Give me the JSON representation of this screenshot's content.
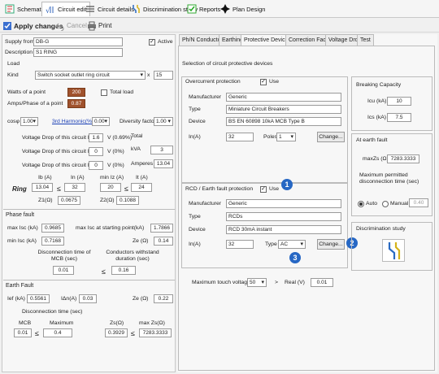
{
  "tabs": [
    {
      "label": "Schematic",
      "icon": "schematic-icon"
    },
    {
      "label": "Circuit edit",
      "icon": "circuit-edit-icon"
    },
    {
      "label": "Circuit details",
      "icon": "circuit-details-icon"
    },
    {
      "label": "Discrimination study",
      "icon": "discrimination-icon"
    },
    {
      "label": "Reports",
      "icon": "reports-icon"
    },
    {
      "label": "Plan Design",
      "icon": "plan-design-icon"
    }
  ],
  "toolbar": {
    "apply": "Apply changes",
    "cancel": "Cancel",
    "print": "Print"
  },
  "left": {
    "supply_from_label": "Supply from",
    "supply_from": "DB-G",
    "active_label": "Active",
    "description_label": "Description",
    "description": "S1 RING",
    "load_header": "Load",
    "kind_label": "Kind",
    "kind": "Switch socket outlet ring circuit",
    "mult": "x",
    "qty": "15",
    "watts_label": "Watts of a point",
    "watts": "200",
    "total_load_label": "Total load",
    "amps_label": "Amps/Phase of a point",
    "amps": "0.87",
    "cosphi_label": "cosφ",
    "cosphi": "1.00",
    "harmonic_label": "3rd Harmonic(%)",
    "harmonic": "0.00",
    "diversity_label": "Diversity factor",
    "diversity": "1.00",
    "vd_l1_label": "Voltage Drop of this circuit L1",
    "vd_l1": "1.6",
    "vd_l1_unit": "V (0.69%)",
    "vd_l2_label": "Voltage Drop of this circuit L2",
    "vd_l2": "0",
    "vd_l2_unit": "V (0%)",
    "vd_l3_label": "Voltage Drop of this circuit L3",
    "vd_l3": "0",
    "vd_l3_unit": "V (0%)",
    "total_label": "Total",
    "kva_label": "kVA",
    "kva": "3",
    "amperes_label": "Amperes",
    "amperes": "13.04",
    "ib_label": "Ib (A)",
    "ib": "13.04",
    "in_label": "In (A)",
    "in": "32",
    "minIz_label": "min Iz (A)",
    "minIz": "20",
    "it_label": "It (A)",
    "it": "24",
    "ring_label": "Ring",
    "le1": "≤",
    "le2": "≤",
    "le3": "≤",
    "z1_label": "Z1(Ω)",
    "z1": "0.0675",
    "z2_label": "Z2(Ω)",
    "z2": "0.1088",
    "phase_fault_header": "Phase fault",
    "maxIsc_label": "max Isc (kA)",
    "maxIsc": "0.9685",
    "maxIscStart_label": "max Isc at starting point(kA)",
    "maxIscStart": "1.7866",
    "minIsc_label": "min Isc (kA)",
    "minIsc": "0.7168",
    "ze_label": "Ze (Ω)",
    "ze": "0.14",
    "disc_mcb_label": "Disconnection time of MCB (sec)",
    "disc_mcb": "0.01",
    "le_pf": "≤",
    "withstand_label": "Conductors withstand duration (sec)",
    "withstand": "0.16",
    "earth_fault_header": "Earth Fault",
    "ief_label": "Ief (kA)",
    "ief": "0.5561",
    "idn_label": "IΔn(A)",
    "idn": "0.03",
    "ze2_label": "Ze (Ω)",
    "ze2": "0.22",
    "disc_time_label": "Disconnection time (sec)",
    "mcb_label": "MCB",
    "mcb": "0.01",
    "max_label": "Maximum",
    "max": "0.4",
    "zs_label": "Zs(Ω)",
    "zs": "0.3929",
    "maxzs_label": "max Zs(Ω)",
    "maxzs": "7283.3333",
    "le_ef1": "≤",
    "le_ef2": "≤"
  },
  "right": {
    "tabs": [
      "Ph/N Conductor",
      "Earthing",
      "Protective Devices",
      "Correction Factors",
      "Voltage Drop",
      "Test"
    ],
    "selection_title": "Selection of circuit protective devices",
    "overcurrent_label": "Overcurrent protection",
    "use_label": "Use",
    "manufacturer_label": "Manufacturer",
    "manufacturer": "Generic",
    "type_label": "Type",
    "type": "Miniature Circuit Breakers",
    "device_label": "Device",
    "device": "BS EN 60898 10kA MCB Type B",
    "in_label": "In(A)",
    "in": "32",
    "poles_label": "Poles",
    "poles": "1",
    "change_label": "Change...",
    "breaking_title": "Breaking Capacity",
    "icu_label": "Icu (kA)",
    "icu": "10",
    "ics_label": "Ics (kA)",
    "ics": "7.5",
    "atearth_title": "At earth fault",
    "maxzs_label": "maxZs (Ω)",
    "maxzs": "7283.3333",
    "maxdisc_title": "Maximum permitted disconnection time (sec)",
    "auto_label": "Auto",
    "manual_label": "Manual",
    "manual_value": "0.40",
    "rcd_label": "RCD / Earth fault protection",
    "rcd_use_label": "Use",
    "rcd_manufacturer": "Generic",
    "rcd_type": "RCDs",
    "rcd_device": "RCD 30mA instant",
    "rcd_in": "32",
    "rcd_type_label": "Type",
    "rcd_type_value": "AC",
    "rcd_change_label": "Change...",
    "disc_study_title": "Discrimination study",
    "touch_label": "Maximum touch voltage",
    "touch": "50",
    "arrow": ">",
    "real_label": "Real (V)",
    "real": "0.01",
    "badge1": "1",
    "badge2": "2",
    "badge3": "3"
  },
  "colors": {
    "brown": "#a0522d",
    "badge": "#2667c4",
    "link": "#1a3fb5"
  }
}
